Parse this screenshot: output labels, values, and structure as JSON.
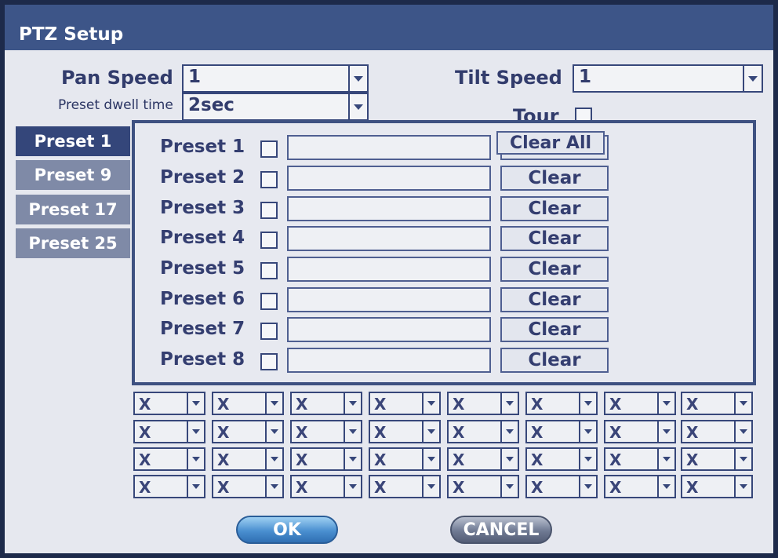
{
  "window": {
    "title": "PTZ Setup"
  },
  "pan_speed": {
    "label": "Pan Speed",
    "value": "1"
  },
  "tilt_speed": {
    "label": "Tilt Speed",
    "value": "1"
  },
  "preset_dwell": {
    "label": "Preset dwell time",
    "value": "2sec"
  },
  "tour": {
    "label": "Tour",
    "checked": false
  },
  "preset_tabs": [
    {
      "label": "Preset 1",
      "active": true
    },
    {
      "label": "Preset 9",
      "active": false
    },
    {
      "label": "Preset 17",
      "active": false
    },
    {
      "label": "Preset 25",
      "active": false
    }
  ],
  "presets": [
    {
      "label": "Preset 1",
      "checked": false,
      "name": "",
      "clear_label": "Clear"
    },
    {
      "label": "Preset 2",
      "checked": false,
      "name": "",
      "clear_label": "Clear"
    },
    {
      "label": "Preset 3",
      "checked": false,
      "name": "",
      "clear_label": "Clear"
    },
    {
      "label": "Preset 4",
      "checked": false,
      "name": "",
      "clear_label": "Clear"
    },
    {
      "label": "Preset 5",
      "checked": false,
      "name": "",
      "clear_label": "Clear"
    },
    {
      "label": "Preset 6",
      "checked": false,
      "name": "",
      "clear_label": "Clear"
    },
    {
      "label": "Preset 7",
      "checked": false,
      "name": "",
      "clear_label": "Clear"
    },
    {
      "label": "Preset 8",
      "checked": false,
      "name": "",
      "clear_label": "Clear"
    }
  ],
  "clear_all_label": "Clear All",
  "tour_grid": [
    [
      "X",
      "X",
      "X",
      "X",
      "X",
      "X",
      "X",
      "X"
    ],
    [
      "X",
      "X",
      "X",
      "X",
      "X",
      "X",
      "X",
      "X"
    ],
    [
      "X",
      "X",
      "X",
      "X",
      "X",
      "X",
      "X",
      "X"
    ],
    [
      "X",
      "X",
      "X",
      "X",
      "X",
      "X",
      "X",
      "X"
    ]
  ],
  "buttons": {
    "ok": "OK",
    "cancel": "CANCEL"
  },
  "colors": {
    "title_bar": "#3d5588",
    "accent": "#34467a",
    "text": "#323c6c"
  }
}
